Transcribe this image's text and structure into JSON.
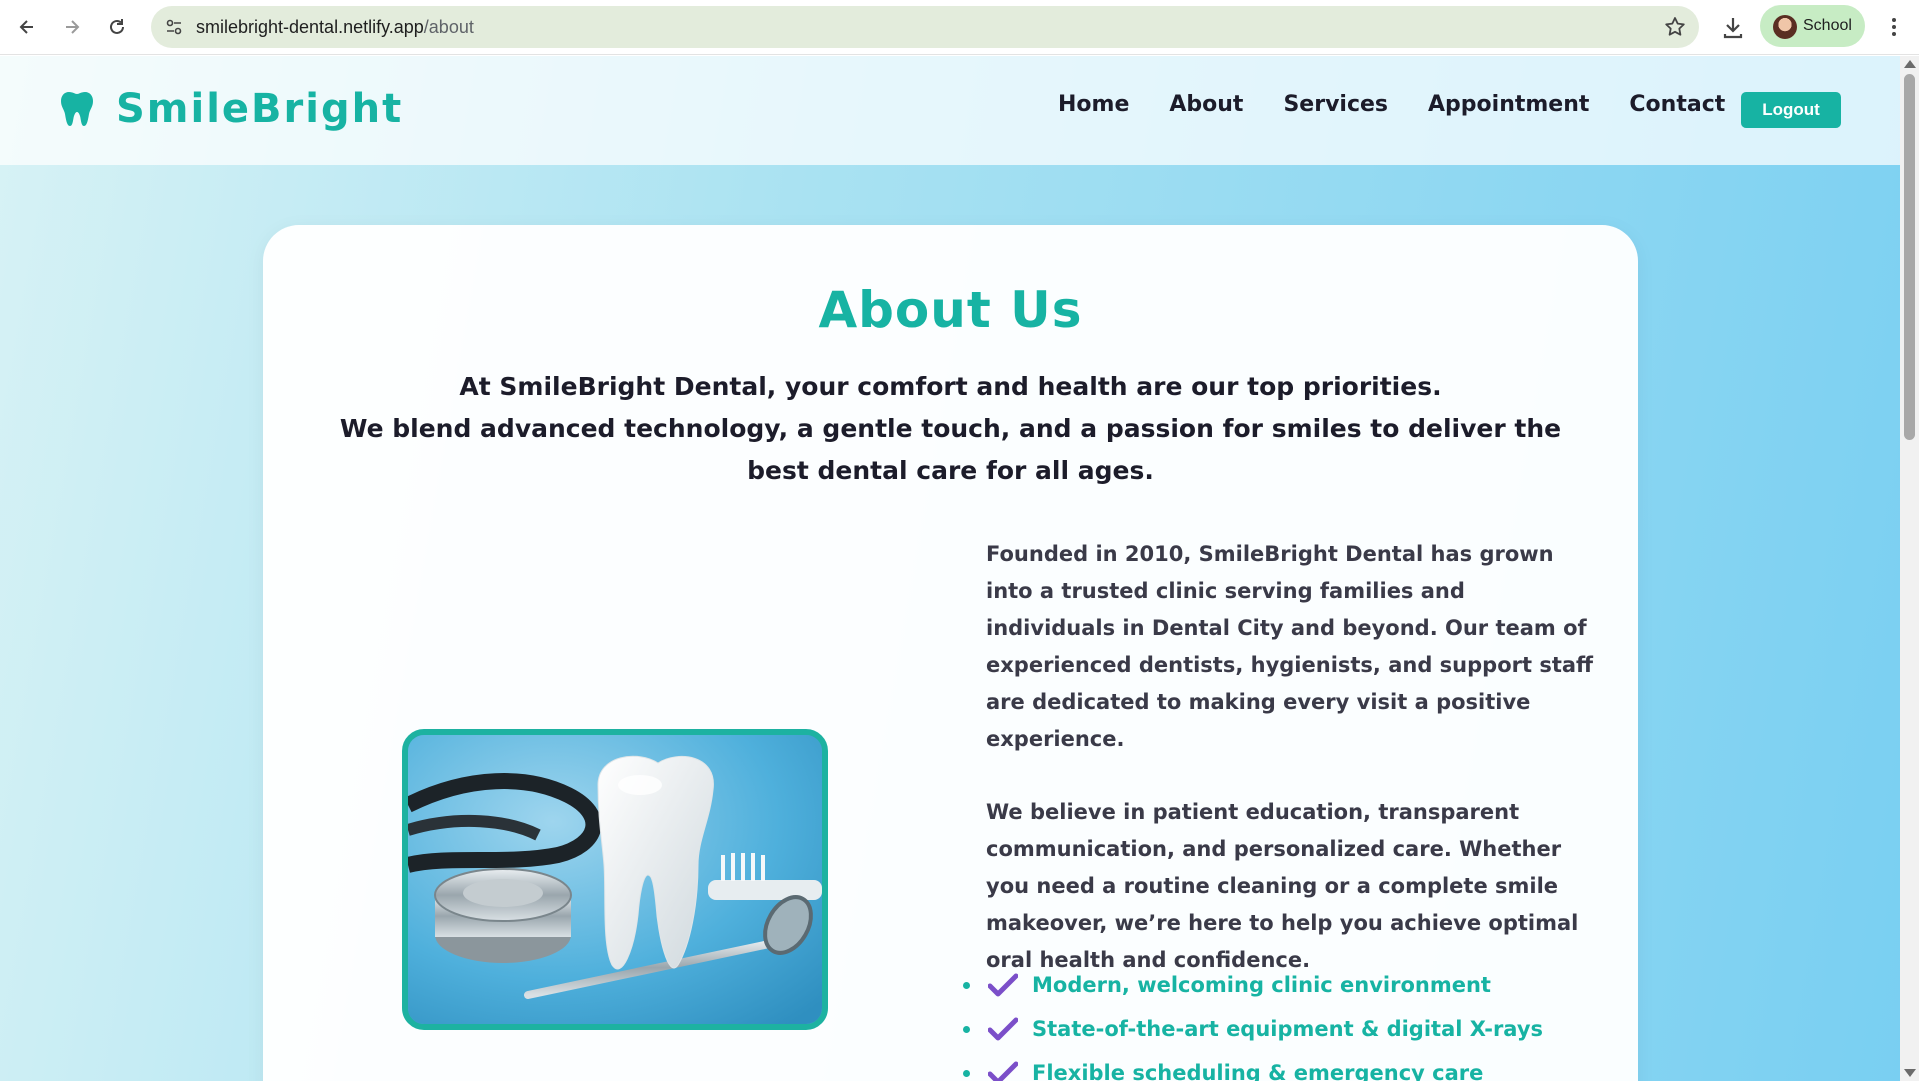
{
  "browser": {
    "url_host": "smilebright-dental.netlify.app",
    "url_path": "/about",
    "profile_label": "School"
  },
  "site": {
    "brand": "SmileBright",
    "nav": [
      "Home",
      "About",
      "Services",
      "Appointment",
      "Contact"
    ],
    "logout_label": "Logout",
    "accent_color": "#17b3a3",
    "check_color": "#7b4fc9"
  },
  "about": {
    "title": "About Us",
    "intro_line1": "At SmileBright Dental, your comfort and health are our top priorities.",
    "intro_line2": "We blend advanced technology, a gentle touch, and a passion for smiles to deliver the best dental care for all ages.",
    "paragraph1": "Founded in 2010, SmileBright Dental has grown into a trusted clinic serving families and individuals in Dental City and beyond. Our team of experienced dentists, hygienists, and support staff are dedicated to making every visit a positive experience.",
    "paragraph2": "We believe in patient education, transparent communication, and personalized care. Whether you need a routine cleaning or a complete smile makeover, we’re here to help you achieve optimal oral health and confidence.",
    "features": [
      "Modern, welcoming clinic environment",
      "State-of-the-art equipment & digital X-rays",
      "Flexible scheduling & emergency care"
    ]
  }
}
